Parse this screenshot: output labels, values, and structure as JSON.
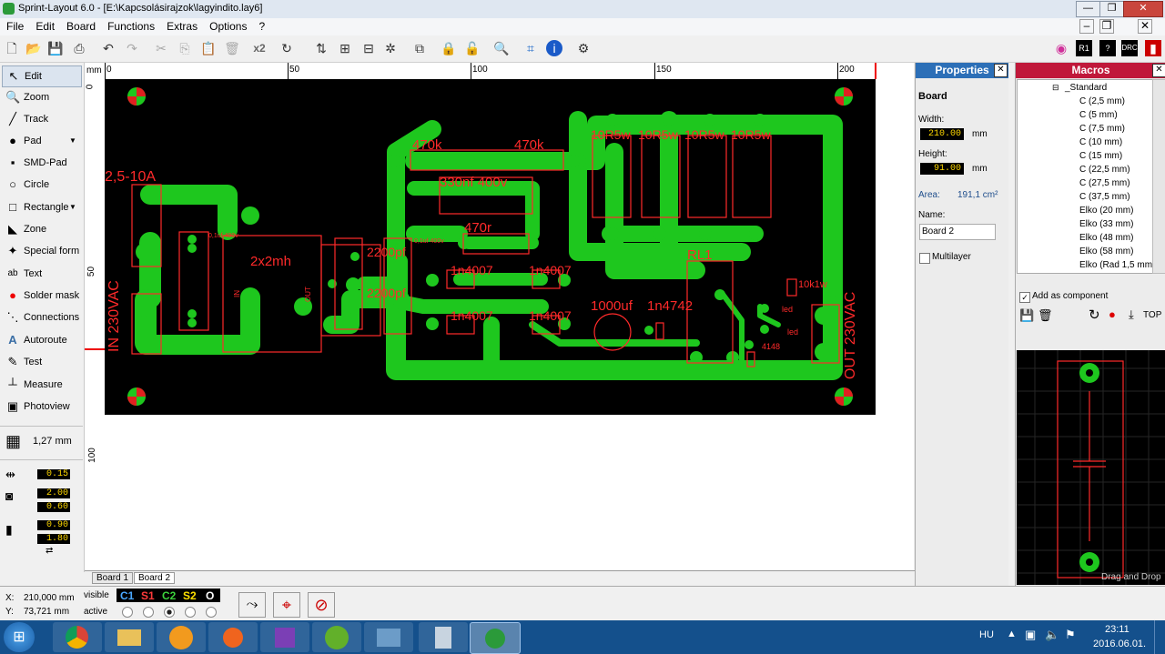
{
  "window": {
    "title": "Sprint-Layout 6.0 - [E:\\Kapcsolásirajzok\\lagyindito.lay6]",
    "min": "—",
    "max": "❐",
    "close": "✕"
  },
  "menu": [
    "File",
    "Edit",
    "Board",
    "Functions",
    "Extras",
    "Options",
    "?"
  ],
  "toolbar": {
    "x2_label": "x2"
  },
  "tools": [
    {
      "label": "Edit",
      "icon": "cursor-icon"
    },
    {
      "label": "Zoom",
      "icon": "zoom-icon"
    },
    {
      "label": "Track",
      "icon": "track-icon"
    },
    {
      "label": "Pad",
      "icon": "pad-icon"
    },
    {
      "label": "SMD-Pad",
      "icon": "smd-pad-icon"
    },
    {
      "label": "Circle",
      "icon": "circle-icon"
    },
    {
      "label": "Rectangle",
      "icon": "rectangle-icon"
    },
    {
      "label": "Zone",
      "icon": "zone-icon"
    },
    {
      "label": "Special form",
      "icon": "special-form-icon"
    },
    {
      "label": "Text",
      "icon": "text-icon"
    },
    {
      "label": "Solder mask",
      "icon": "solder-mask-icon"
    },
    {
      "label": "Connections",
      "icon": "connections-icon"
    },
    {
      "label": "Autoroute",
      "icon": "autoroute-icon"
    },
    {
      "label": "Test",
      "icon": "test-icon"
    },
    {
      "label": "Measure",
      "icon": "measure-icon"
    },
    {
      "label": "Photoview",
      "icon": "photoview-icon"
    }
  ],
  "grid": {
    "value": "1,27 mm"
  },
  "params": {
    "track_width": "0.15",
    "pad_outer": "2.00",
    "pad_inner": "0.60",
    "smd_w": "0.90",
    "smd_h": "1.80"
  },
  "ruler": {
    "unit": "mm",
    "h_labels": [
      "0",
      "50",
      "100",
      "150",
      "200"
    ],
    "v_labels": [
      "0",
      "50",
      "100"
    ]
  },
  "board_text": {
    "label_25": "2,5-10A",
    "r470k_1": "470k",
    "r470k_2": "470k",
    "c330": "330nf 400v",
    "r470r": "470r",
    "c2200_1": "2200pf",
    "c2200_2": "2200pf",
    "coil": "2x2mh",
    "d1": "1n4007",
    "d2": "1n4007",
    "d3": "1n4007",
    "d4": "1n4007",
    "r10r_1": "10R5w",
    "r10r_2": "10R5w",
    "r10r_3": "10R5w",
    "r10r_4": "10R5w",
    "rl1": "RL1",
    "c1000": "1000uf",
    "z4742": "1n4742",
    "in": "IN 230VAC",
    "out": "OUT 230VAC",
    "r10k": "10k1w",
    "led": "led",
    "led2": "led",
    "d4148": "4148",
    "ct_in": "IN",
    "ct_out": "OUT",
    "small1": "0,1uf 400v",
    "small2": "0,1uf 400v"
  },
  "tabs": [
    "Board 1",
    "Board 2"
  ],
  "properties": {
    "header": "Properties",
    "section": "Board",
    "width_label": "Width:",
    "width_value": "210.00",
    "unit": "mm",
    "height_label": "Height:",
    "height_value": "91.00",
    "area_label": "Area:",
    "area_value": "191,1 cm²",
    "name_label": "Name:",
    "name_value": "Board 2",
    "multilayer": "Multilayer"
  },
  "macros": {
    "header": "Macros",
    "items": [
      "_Standard",
      "C (2,5 mm)",
      "C (5 mm)",
      "C (7,5 mm)",
      "C (10 mm)",
      "C (15 mm)",
      "C (22,5 mm)",
      "C (27,5 mm)",
      "C (37,5 mm)",
      "Elko (20 mm)",
      "Elko (33 mm)",
      "Elko (48 mm)",
      "Elko (58 mm)",
      "Elko (Rad 1,5 mm"
    ],
    "add_component": "Add as component",
    "top": "TOP",
    "drag_drop": "Drag and Drop"
  },
  "status": {
    "x_label": "X:",
    "x_value": "210,000 mm",
    "y_label": "Y:",
    "y_value": "73,721 mm",
    "visible": "visible",
    "active": "active",
    "layers": [
      {
        "name": "C1",
        "color": "#4aa8ff"
      },
      {
        "name": "S1",
        "color": "#ff3b3b"
      },
      {
        "name": "C2",
        "color": "#3cd23c"
      },
      {
        "name": "S2",
        "color": "#ffe000"
      },
      {
        "name": "O",
        "color": "#ffffff"
      }
    ]
  },
  "taskbar": {
    "lang": "HU",
    "time": "23:11",
    "date": "2016.06.01."
  },
  "colors": {
    "copper": "#1ec71e",
    "silk": "#ff2a2a",
    "board": "#000000",
    "accent_blue": "#14508c"
  }
}
